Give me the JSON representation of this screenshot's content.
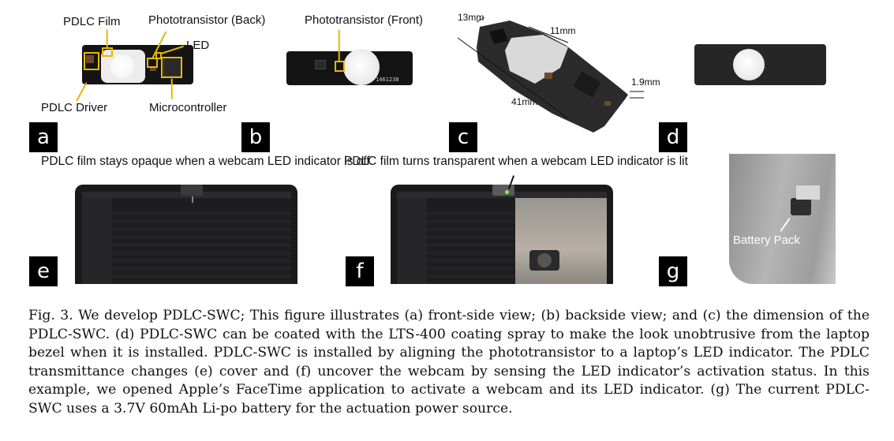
{
  "labels": {
    "pdlc_film": "PDLC Film",
    "pt_back": "Phototransistor (Back)",
    "led": "LED",
    "pdlc_driver": "PDLC Driver",
    "microcontroller": "Microcontroller",
    "pt_front": "Phototransistor (Front)",
    "dim_13": "13mm",
    "dim_11a": "11mm",
    "dim_11b": "11mm",
    "dim_19": "1.9mm",
    "dim_41": "41mm",
    "battery_pack": "Battery Pack",
    "board_code": "1461238"
  },
  "panel_letters": [
    "a",
    "b",
    "c",
    "d",
    "e",
    "f",
    "g"
  ],
  "subtitles": {
    "e": "PDLC film stays opaque when a webcam LED indicator is off",
    "f": "PDLC film turns transparent when a webcam LED indicator is lit"
  },
  "caption": "Fig. 3.  We develop PDLC-SWC; This figure illustrates (a) front-side view; (b) backside view; and (c) the dimension of the PDLC-SWC. (d) PDLC-SWC can be coated with the LTS-400 coating spray to make the look unobtrusive from the laptop bezel when it is installed. PDLC-SWC is installed by aligning the phototransistor to a laptop’s LED indicator. The PDLC transmittance changes (e) cover and (f) uncover the webcam by sensing the LED indicator’s activation status. In this example, we opened Apple’s FaceTime application to activate a webcam and its LED indicator. (g) The current PDLC-SWC uses a 3.7V 60mAh Li-po battery for the actuation power source.",
  "colors": {
    "highlight": "#e6b800",
    "pcb": "#141414",
    "background": "#ffffff"
  }
}
